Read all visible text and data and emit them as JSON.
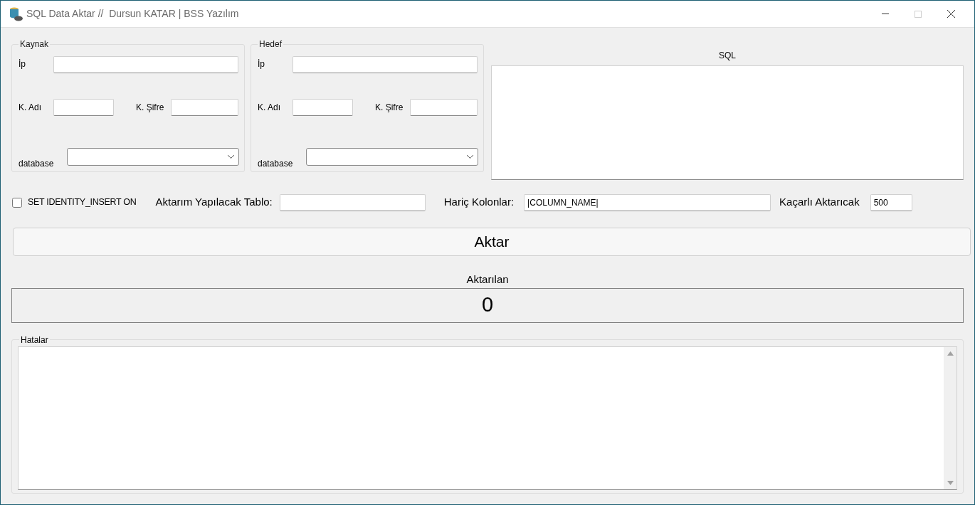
{
  "window": {
    "title": "SQL Data Aktar //  Dursun KATAR | BSS Yazılım",
    "maximize_enabled": false
  },
  "groups": [
    {
      "legend": "Kaynak",
      "ip_label": "İp",
      "user_label": "K. Adı",
      "password_label": "K. Şifre",
      "database_label": "database"
    },
    {
      "legend": "Hedef",
      "ip_label": "İp",
      "user_label": "K. Adı",
      "password_label": "K. Şifre",
      "database_label": "database"
    }
  ],
  "sql": {
    "label": "SQL"
  },
  "options": {
    "identity_insert": {
      "label": "SET IDENTITY_INSERT ON",
      "checked": false
    },
    "table_label": "Aktarım Yapılacak Tablo:",
    "excluded_label": "Hariç Kolonlar:",
    "excluded_value": "|COLUMN_NAME|",
    "batch_label": "Kaçarlı Aktarıcak",
    "batch_value": "500"
  },
  "transfer_button": "Aktar",
  "transferred": {
    "label": "Aktarılan",
    "value": "0"
  },
  "errors": {
    "legend": "Hatalar"
  }
}
